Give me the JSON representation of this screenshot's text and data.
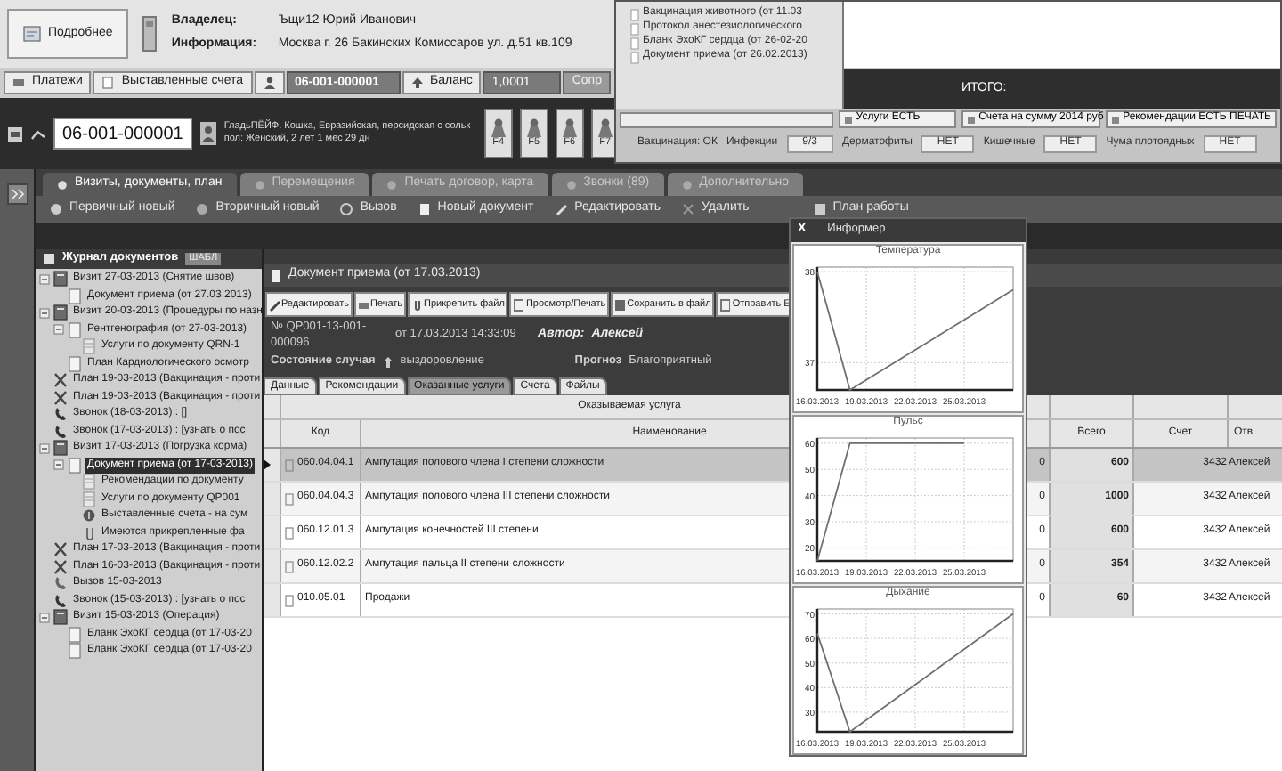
{
  "owner_panel": {
    "details_button": "Подробнее",
    "owner_label": "Владелец:",
    "owner": "Ъщи12 Юрий Иванович",
    "info_label": "Информация:",
    "info": "Москва г. 26 Бакинских Комиссаров ул. д.51 кв.109"
  },
  "account_bar": {
    "payments_button": "Платежи",
    "invoices_button": "Выставленные счета",
    "card_number": "06-001-000001",
    "balance_button": "Баланс",
    "balance": "1,0001",
    "next_button": "Сопр"
  },
  "patient": {
    "number": "06-001-000001",
    "line_1": "ГладьПЁЙФ. Кошка, Евразийская, персидская с сольк",
    "line_2": "пол: Женский, 2 лет 1 мес 29 дн",
    "function_keys": [
      "F4",
      "F5",
      "F6",
      "F7"
    ]
  },
  "tabs": [
    {
      "label": "Визиты, документы, план",
      "selected": true
    },
    {
      "label": "Перемещения",
      "selected": false
    },
    {
      "label": "Печать договор, карта",
      "selected": false
    },
    {
      "label": "Звонки (89)",
      "selected": false
    },
    {
      "label": "Дополнительно",
      "selected": false
    }
  ],
  "actions": [
    "Первичный новый",
    "Вторичный новый",
    "Вызов",
    "Новый документ",
    "Редактировать",
    "Удалить",
    "План работы"
  ],
  "journal": {
    "title": "Журнал документов",
    "badge": "ШАБЛ",
    "items": [
      {
        "label": "Визит 27-03-2013 (Снятие швов)",
        "kind": "visit",
        "selected": false,
        "children": [
          {
            "label": "Документ приема (от 27.03.2013)",
            "kind": "document",
            "selected": false
          }
        ]
      },
      {
        "label": "Визит 20-03-2013 (Процедуры по назн",
        "kind": "visit",
        "selected": false,
        "children": [
          {
            "label": "Рентгенография (от 27-03-2013)",
            "kind": "document",
            "selected": false,
            "children": [
              {
                "label": "Услуги по документу QRN-1",
                "kind": "services",
                "selected": false
              }
            ]
          },
          {
            "label": "План Кардиологического осмотр",
            "kind": "document",
            "selected": false
          }
        ]
      },
      {
        "label": "План 19-03-2013 (Вакцинация - проти",
        "kind": "plan",
        "selected": false
      },
      {
        "label": "План 19-03-2013 (Вакцинация - проти",
        "kind": "plan",
        "selected": false
      },
      {
        "label": "Звонок (18-03-2013) : []",
        "kind": "call",
        "selected": false
      },
      {
        "label": "Звонок (17-03-2013) : [узнать о пос",
        "kind": "call",
        "selected": false
      },
      {
        "label": "Визит 17-03-2013 (Погрузка корма)",
        "kind": "visit",
        "selected": false,
        "children": [
          {
            "label": "Документ приема (от 17-03-2013)",
            "kind": "document",
            "selected": true,
            "children": [
              {
                "label": "Рекомендации по документу",
                "kind": "services",
                "selected": false
              },
              {
                "label": "Услуги по документу QP001",
                "kind": "services",
                "selected": false
              },
              {
                "label": "Выставленные счета - на сум",
                "kind": "invoice",
                "selected": false
              },
              {
                "label": "Имеются прикрепленные фа",
                "kind": "file",
                "selected": false
              }
            ]
          }
        ]
      },
      {
        "label": "План 17-03-2013 (Вакцинация - проти",
        "kind": "plan",
        "selected": false
      },
      {
        "label": "План 16-03-2013 (Вакцинация - проти",
        "kind": "plan",
        "selected": false
      },
      {
        "label": "Вызов 15-03-2013",
        "kind": "outcall",
        "selected": false
      },
      {
        "label": "Звонок (15-03-2013) : [узнать о пос",
        "kind": "call",
        "selected": false
      },
      {
        "label": "Визит 15-03-2013 (Операция)",
        "kind": "visit",
        "selected": false,
        "children": [
          {
            "label": "Бланк ЭхоКГ сердца (от 17-03-20",
            "kind": "document",
            "selected": false
          },
          {
            "label": "Бланк ЭхоКГ сердца (от 17-03-20",
            "kind": "document",
            "selected": false
          }
        ]
      }
    ]
  },
  "document": {
    "title": "Документ приема (от 17.03.2013)",
    "buttons": [
      "Редактировать",
      "Печать",
      "Прикрепить файл",
      "Просмотр/Печать",
      "Сохранить в файл",
      "Отправить Е"
    ],
    "number": "№ QP001-13-001-000096",
    "date": "от 17.03.2013 14:33:09",
    "author_label": "Автор:",
    "author": "Алексей",
    "state_label": "Состояние случая",
    "state": "выздоровление",
    "prognosis_label": "Прогноз",
    "prognosis": "Благоприятный",
    "subtabs": [
      {
        "label": "Данные",
        "selected": false
      },
      {
        "label": "Рекомендации",
        "selected": false
      },
      {
        "label": "Оказанные услуги",
        "selected": true
      },
      {
        "label": "Счета",
        "selected": false
      },
      {
        "label": "Файлы",
        "selected": false
      }
    ],
    "table": {
      "group_header": "Оказываемая услуга",
      "columns": {
        "code": "Код",
        "name": "Наименование",
        "total": "Всего",
        "account": "Счет",
        "responsible": "Отв"
      },
      "rows": [
        {
          "selected": true,
          "code": "060.04.04.1",
          "name": "Ампутация полового члена I степени сложности",
          "column_3": "0",
          "total": "600",
          "account": "3432",
          "responsible": "Алексей"
        },
        {
          "selected": false,
          "code": "060.04.04.3",
          "name": "Ампутация полового члена III степени сложности",
          "column_3": "0",
          "total": "1000",
          "account": "3432",
          "responsible": "Алексей"
        },
        {
          "selected": false,
          "code": "060.12.01.3",
          "name": "Ампутация конечностей III степени",
          "column_3": "0",
          "total": "600",
          "account": "3432",
          "responsible": "Алексей"
        },
        {
          "selected": false,
          "code": "060.12.02.2",
          "name": "Ампутация пальца II степени сложности",
          "column_3": "0",
          "total": "354",
          "account": "3432",
          "responsible": "Алексей"
        },
        {
          "selected": false,
          "code": "010.05.01",
          "name": "Продажи",
          "column_3": "0",
          "total": "60",
          "account": "3432",
          "responsible": "Алексей"
        }
      ]
    }
  },
  "overlay_window": {
    "items": [
      "Вакцинация животного (от 11.03",
      "Протокол анестезиологического",
      "Бланк ЭхоКГ сердца (от 26-02-20",
      "Документ приема (от 26.02.2013)"
    ],
    "total_label": "ИТОГО:",
    "status": [
      "Услуги ЕСТЬ",
      "Счета на сумму 2014 руб",
      "Рекомендации ЕСТЬ ПЕЧАТЬ"
    ],
    "indicators": [
      {
        "label": "Вакцинация: ОК"
      },
      {
        "label": "Инфекции",
        "value": "9/3"
      },
      {
        "label": "Дерматофиты",
        "value": "НЕТ"
      },
      {
        "label": "Кишечные",
        "value": "НЕТ"
      },
      {
        "label": "Чума плотоядных",
        "value": "НЕТ"
      }
    ]
  },
  "informer": {
    "title": "Информер",
    "close": "X",
    "charts": [
      {
        "chart_data": {
          "type": "line",
          "title": "Температура",
          "categories": [
            "16.03.2013",
            null,
            null,
            "19.03.2013",
            null,
            null,
            "22.03.2013",
            null,
            null,
            "25.03.2013",
            null,
            null,
            null
          ],
          "series": [
            {
              "color": "#707070",
              "values": [
                38,
                37.35,
                36.7,
                36.81,
                36.92,
                37.03,
                37.14,
                37.25,
                37.36,
                37.47,
                37.58,
                37.69,
                37.8
              ]
            }
          ],
          "ylim": [
            36.7,
            38.05
          ],
          "yticks": [
            37,
            38
          ],
          "grid": true
        }
      },
      {
        "chart_data": {
          "type": "line",
          "title": "Пульс",
          "categories": [
            "16.03.2013",
            null,
            null,
            "19.03.2013",
            null,
            null,
            "22.03.2013",
            null,
            null,
            "25.03.2013",
            null,
            null,
            null
          ],
          "series": [
            {
              "color": "#707070",
              "values": [
                15,
                37.5,
                60,
                60,
                60,
                60,
                60,
                60,
                60,
                60,
                null,
                null,
                null
              ]
            }
          ],
          "ylim": [
            15,
            62
          ],
          "yticks": [
            20,
            30,
            40,
            50,
            60
          ],
          "grid": true
        }
      },
      {
        "chart_data": {
          "type": "line",
          "title": "Дыхание",
          "categories": [
            "16.03.2013",
            null,
            null,
            "19.03.2013",
            null,
            null,
            "22.03.2013",
            null,
            null,
            "25.03.2013",
            null,
            null,
            null
          ],
          "series": [
            {
              "color": "#707070",
              "values": [
                62,
                42,
                22,
                26.8,
                31.6,
                36.4,
                41.2,
                46,
                50.8,
                55.6,
                60.4,
                65.2,
                70
              ]
            }
          ],
          "ylim": [
            22,
            72
          ],
          "yticks": [
            30,
            40,
            50,
            60,
            70
          ],
          "grid": true
        }
      }
    ]
  }
}
